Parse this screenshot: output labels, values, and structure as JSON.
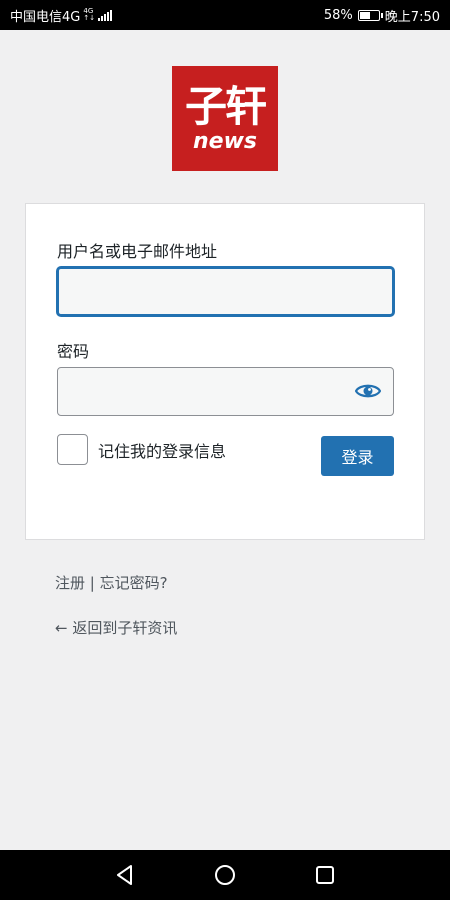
{
  "status_bar": {
    "carrier": "中国电信4G",
    "network_badge_top": "4G",
    "network_badge_bottom": "↑↓",
    "battery": "58%",
    "battery_level": 0.58,
    "time": "晚上7:50"
  },
  "logo": {
    "main_text": "子轩",
    "sub_text": "news",
    "background_color": "#c61f1f"
  },
  "form": {
    "username_label": "用户名或电子邮件地址",
    "username_value": "",
    "password_label": "密码",
    "password_value": "",
    "show_password_icon": "eye-icon",
    "remember_label": "记住我的登录信息",
    "remember_checked": false,
    "login_button": "登录",
    "accent_color": "#2271b1"
  },
  "links": {
    "register": "注册",
    "separator": "|",
    "lost_password": "忘记密码?",
    "back_to_site": "← 返回到子轩资讯"
  },
  "nav_bar": {
    "back": "back-triangle-icon",
    "home": "home-circle-icon",
    "recents": "recents-square-icon"
  }
}
